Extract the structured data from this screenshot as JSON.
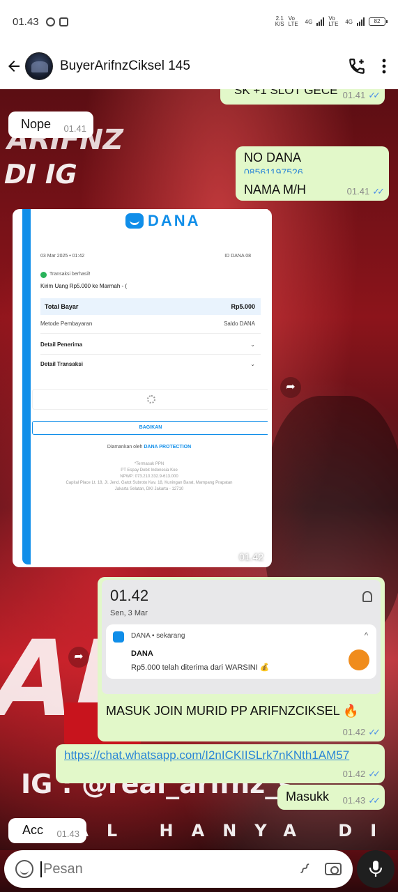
{
  "status_bar": {
    "time": "01.43",
    "network_1": "2.1",
    "network_1_unit": "K/S",
    "sim1_label": "Vo LTE",
    "sim1_tech": "4G",
    "sim2_label": "Vo LTE",
    "sim2_tech": "4G",
    "battery": "82"
  },
  "header": {
    "contact_name": "BuyerArifnzCiksel 145",
    "call_icon": "call-add-icon",
    "menu_icon": "more-vert-icon"
  },
  "background_art": {
    "text_1": "ARIFNZ",
    "text_2": "DI IG",
    "text_3": "AR",
    "text_4": "IG : @real_arifnz_s",
    "text_5": "DEAL HANYA DI I"
  },
  "messages": {
    "m0": {
      "text": "SK +1 SLOT GECE",
      "time": "01.41",
      "ticks": "✓✓"
    },
    "m1": {
      "text": "Nope",
      "time": "01.41"
    },
    "m2": {
      "line1": "NO DANA",
      "line2": "08561197526",
      "line3": "NAMA M/H",
      "time": "01.41",
      "ticks": "✓✓"
    },
    "m3": {
      "time": "01.42",
      "receipt": {
        "brand": "DANA",
        "date": "03 Mar 2025 • 01:42",
        "id": "ID DANA 08",
        "status": "Transaksi berhasil!",
        "title": "Kirim Uang Rp5.000 ke Marmah - (",
        "total_label": "Total Bayar",
        "total_value": "Rp5.000",
        "method_label": "Metode Pembayaran",
        "method_value": "Saldo DANA",
        "detail_penerima": "Detail Penerima",
        "detail_transaksi": "Detail Transaksi",
        "share_button": "BAGIKAN",
        "secured_by": "Diamankan oleh",
        "protection": "DANA PROTECTION",
        "footer_1": "*Termasuk PPN",
        "footer_2": "PT Espay Debit Indonesia Koe",
        "footer_3": "NPWP: 073.210.332.9-613.000",
        "footer_4": "Capital Place Lt. 18, Jl. Jend. Gatot Subroto Kav. 18, Kuningan Barat, Mampang Prapatan",
        "footer_5": "Jakarta Selatan, DKI Jakarta - 12710"
      }
    },
    "m4": {
      "notif_time": "01.42",
      "notif_date": "Sen, 3 Mar",
      "notif_app": "DANA • sekarang",
      "notif_title": "DANA",
      "notif_body": "Rp5.000 telah diterima dari WARSINI 💰",
      "caption": "MASUK JOIN MURID PP ARIFNZCIKSEL 🔥",
      "time": "01.42",
      "ticks": "✓✓"
    },
    "m5": {
      "text": "https://chat.whatsapp.com/I2nICKIISLrk7nKNth1AM57",
      "time": "01.42",
      "ticks": "✓✓"
    },
    "m6": {
      "text": "Masukk",
      "time": "01.43",
      "ticks": "✓✓"
    },
    "m7": {
      "text": "Acc",
      "time": "01.43"
    }
  },
  "composer": {
    "placeholder": "Pesan",
    "emoji_icon": "emoji-icon",
    "attach_icon": "attach-icon",
    "camera_icon": "camera-icon",
    "mic_icon": "mic-icon"
  }
}
